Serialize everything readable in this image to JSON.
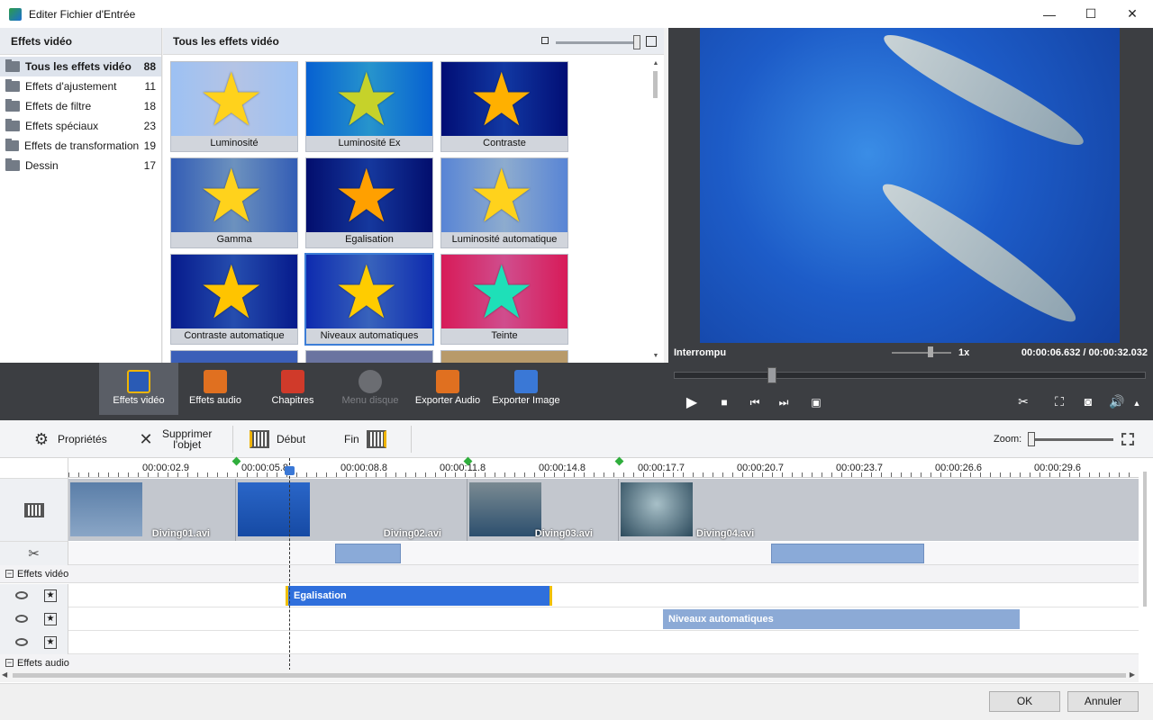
{
  "window": {
    "title": "Editer Fichier d'Entrée",
    "minimize": "—",
    "maximize": "☐",
    "close": "✕"
  },
  "categories": {
    "header": "Effets vidéo",
    "items": [
      {
        "label": "Tous les effets vidéo",
        "count": "88",
        "selected": true
      },
      {
        "label": "Effets d'ajustement",
        "count": "11"
      },
      {
        "label": "Effets de filtre",
        "count": "18"
      },
      {
        "label": "Effets spéciaux",
        "count": "23"
      },
      {
        "label": "Effets de transformation",
        "count": "19"
      },
      {
        "label": "Dessin",
        "count": "17"
      }
    ]
  },
  "effects": {
    "header": "Tous les effets vidéo",
    "tiles": [
      {
        "label": "Luminosité",
        "bg": "#8fa6d8",
        "star": "#ffd21c"
      },
      {
        "label": "Luminosité Ex",
        "bg": "#1d6fb3",
        "star": "#c6d22a"
      },
      {
        "label": "Contraste",
        "bg": "#0d2a7a",
        "star": "#ffb000"
      },
      {
        "label": "Gamma",
        "bg": "#516d9e",
        "star": "#ffd21c"
      },
      {
        "label": "Egalisation",
        "bg": "#102a76",
        "star": "#ffa000"
      },
      {
        "label": "Luminosité automatique",
        "bg": "#6a82b6",
        "star": "#ffd21c"
      },
      {
        "label": "Contraste automatique",
        "bg": "#1c3a86",
        "star": "#ffc400"
      },
      {
        "label": "Niveaux automatiques",
        "bg": "#2a4a9a",
        "star": "#ffcc00"
      },
      {
        "label": "Teinte",
        "bg": "#b83a6a",
        "star": "#1ee0b8"
      }
    ]
  },
  "preview": {
    "status": "Interrompu",
    "speed": "1x",
    "current_time": "00:00:06.632",
    "separator": "/",
    "total_time": "00:00:32.032",
    "seek_fraction": 0.207
  },
  "toolbar": {
    "items": [
      {
        "label": "Effets vidéo",
        "icon": "video-effects-icon",
        "color": "#f0b400"
      },
      {
        "label": "Effets audio",
        "icon": "audio-effects-icon",
        "color": "#e07020"
      },
      {
        "label": "Chapitres",
        "icon": "chapters-icon",
        "color": "#d03a2a"
      },
      {
        "label": "Menu disque",
        "icon": "disc-menu-icon",
        "color": "#7d7f84"
      },
      {
        "label": "Exporter Audio",
        "icon": "export-audio-icon",
        "color": "#e07020"
      },
      {
        "label": "Exporter Image",
        "icon": "export-image-icon",
        "color": "#3a78d6"
      }
    ]
  },
  "props": {
    "properties": "Propriétés",
    "delete_line1": "Supprimer",
    "delete_line2": "l'objet",
    "start": "Début",
    "end": "Fin",
    "zoom": "Zoom:"
  },
  "timeline": {
    "ruler": [
      "00:00:02.9",
      "00:00:05.8",
      "00:00:08.8",
      "00:00:11.8",
      "00:00:14.8",
      "00:00:17.7",
      "00:00:20.7",
      "00:00:23.7",
      "00:00:26.6",
      "00:00:29.6"
    ],
    "clips": [
      "Diving01.avi",
      "Diving02.avi",
      "Diving03.avi",
      "Diving04.avi"
    ],
    "video_effects_group": "Effets vidéo",
    "audio_effects_group": "Effets audio",
    "effects": [
      {
        "label": "Egalisation",
        "state": "active"
      },
      {
        "label": "Niveaux automatiques",
        "state": "inactive"
      }
    ]
  },
  "footer": {
    "ok": "OK",
    "cancel": "Annuler"
  }
}
